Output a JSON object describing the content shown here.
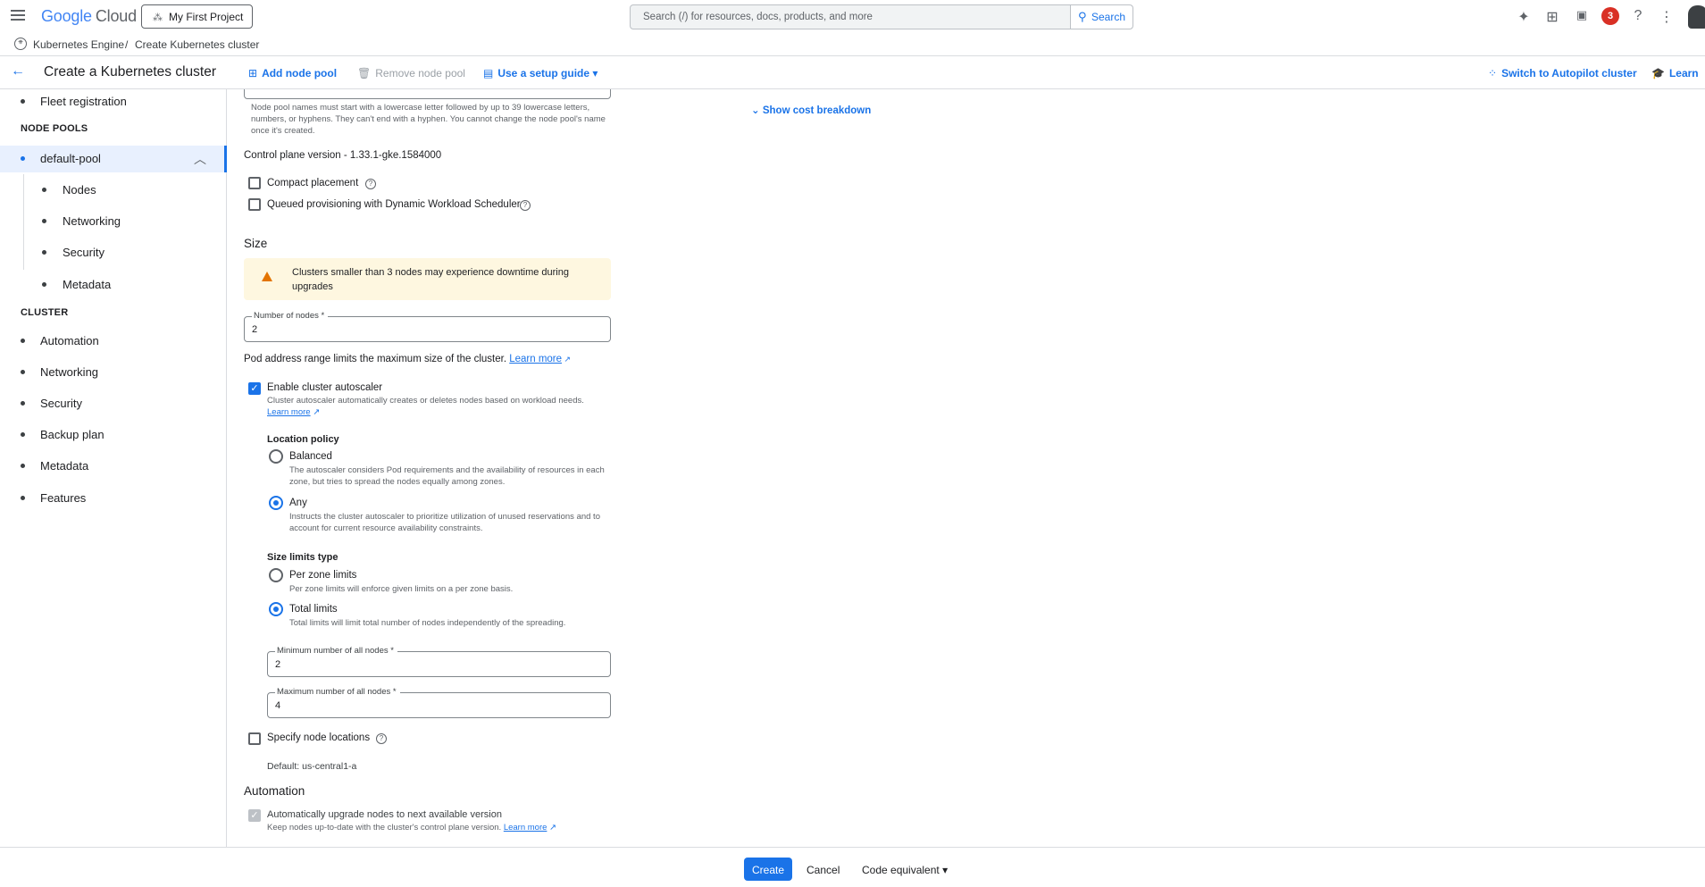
{
  "topbar": {
    "logo_google": "Google",
    "logo_cloud": "Cloud",
    "project": "My First Project",
    "search_placeholder": "Search (/) for resources, docs, products, and more",
    "search_button": "Search",
    "notification_count": "3"
  },
  "breadcrumb": {
    "item1": "Kubernetes Engine",
    "separator": "/",
    "item2": "Create Kubernetes cluster"
  },
  "header": {
    "title": "Create a Kubernetes cluster",
    "add_node_pool": "Add node pool",
    "remove_node_pool": "Remove node pool",
    "setup_guide": "Use a setup guide",
    "switch_autopilot": "Switch to Autopilot cluster",
    "learn": "Learn"
  },
  "sidebar": {
    "fleet_registration": "Fleet registration",
    "node_pools_heading": "NODE POOLS",
    "default_pool": "default-pool",
    "pool_items": [
      "Nodes",
      "Networking",
      "Security",
      "Metadata"
    ],
    "cluster_heading": "CLUSTER",
    "cluster_items": [
      "Automation",
      "Networking",
      "Security",
      "Backup plan",
      "Metadata",
      "Features"
    ]
  },
  "main": {
    "node_pool_help": "Node pool names must start with a lowercase letter followed by up to 39 lowercase letters, numbers, or hyphens. They can't end with a hyphen. You cannot change the node pool's name once it's created.",
    "show_cost": "Show cost breakdown",
    "control_plane": "Control plane version - 1.33.1-gke.1584000",
    "compact_placement": "Compact placement",
    "queued_provisioning": "Queued provisioning with Dynamic Workload Scheduler",
    "size_heading": "Size",
    "warning": "Clusters smaller than 3 nodes may experience downtime during upgrades",
    "num_nodes_label": "Number of nodes *",
    "num_nodes_value": "2",
    "pod_range_text": "Pod address range limits the maximum size of the cluster.",
    "learn_more": "Learn more",
    "enable_autoscaler": "Enable cluster autoscaler",
    "autoscaler_help": "Cluster autoscaler automatically creates or deletes nodes based on workload needs.",
    "location_policy": "Location policy",
    "balanced": "Balanced",
    "balanced_help": "The autoscaler considers Pod requirements and the availability of resources in each zone, but tries to spread the nodes equally among zones.",
    "any": "Any",
    "any_help": "Instructs the cluster autoscaler to prioritize utilization of unused reservations and to account for current resource availability constraints.",
    "size_limits_type": "Size limits type",
    "per_zone": "Per zone limits",
    "per_zone_help": "Per zone limits will enforce given limits on a per zone basis.",
    "total_limits": "Total limits",
    "total_limits_help": "Total limits will limit total number of nodes independently of the spreading.",
    "min_label": "Minimum number of all nodes *",
    "min_value": "2",
    "max_label": "Maximum number of all nodes *",
    "max_value": "4",
    "specify_locations": "Specify node locations",
    "default_location": "Default: us-central1-a",
    "automation_heading": "Automation",
    "auto_upgrade": "Automatically upgrade nodes to next available version",
    "auto_upgrade_help": "Keep nodes up-to-date with the cluster's control plane version."
  },
  "footer": {
    "create": "Create",
    "cancel": "Cancel",
    "code_equivalent": "Code equivalent"
  }
}
